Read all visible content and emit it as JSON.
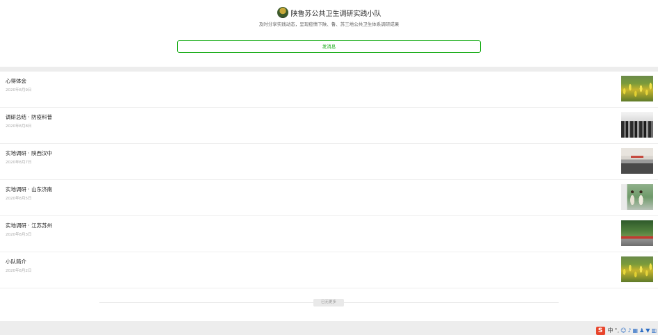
{
  "header": {
    "title": "陕鲁苏公共卫生调研实践小队",
    "subtitle": "及时分享实践动态，呈现疫情下陕、鲁、苏三地公共卫生体系调研成果",
    "post_button": "发消息"
  },
  "articles": [
    {
      "title": "心得体会",
      "date": "2020年8月9日",
      "thumb": "yellow-flowers"
    },
    {
      "title": "调研总结 · 防疫科普",
      "date": "2020年8月8日",
      "thumb": "crowd-outdoors"
    },
    {
      "title": "实地调研 · 陕西汉中",
      "date": "2020年8月7日",
      "thumb": "building-entrance"
    },
    {
      "title": "实地调研 · 山东济南",
      "date": "2020年8月5日",
      "thumb": "two-people"
    },
    {
      "title": "实地调研 · 江苏苏州",
      "date": "2020年8月3日",
      "thumb": "park-banner"
    },
    {
      "title": "小队简介",
      "date": "2020年8月2日",
      "thumb": "yellow-flowers"
    }
  ],
  "list_end": "已无更多",
  "tray": {
    "ime_logo": "S",
    "ime_mode": "中",
    "icons": [
      "punctuation-icon",
      "emoji-icon",
      "microphone-icon",
      "keyboard-icon",
      "user-icon",
      "shirt-icon",
      "grid-icon"
    ]
  }
}
